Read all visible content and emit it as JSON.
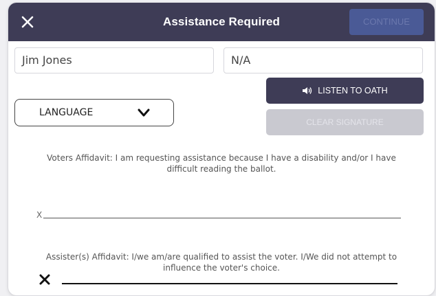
{
  "header": {
    "title": "Assistance Required",
    "close_icon": "close-icon",
    "continue_label": "CONTINUE"
  },
  "form": {
    "name_value": "Jim Jones",
    "second_value": "N/A"
  },
  "language": {
    "label": "LANGUAGE",
    "icon": "chevron-down-icon"
  },
  "actions": {
    "listen_label": "LISTEN TO OATH",
    "listen_icon": "speaker-icon",
    "clear_label": "CLEAR SIGNATURE"
  },
  "affidavits": {
    "voter": "Voters Affidavit: I am requesting assistance because I have a disability and/or I have difficult reading the ballot.",
    "voter_sig_mark": "X",
    "assister": "Assister(s) Affidavit: I/we am/are qualified to assist the voter. I/We did not attempt to influence the voter's choice.",
    "assister_sig_icon": "x-mark-icon"
  },
  "colors": {
    "header_bg": "#3e3c56",
    "continue_bg": "#4a5a96",
    "clear_bg": "#c9c9d0"
  }
}
